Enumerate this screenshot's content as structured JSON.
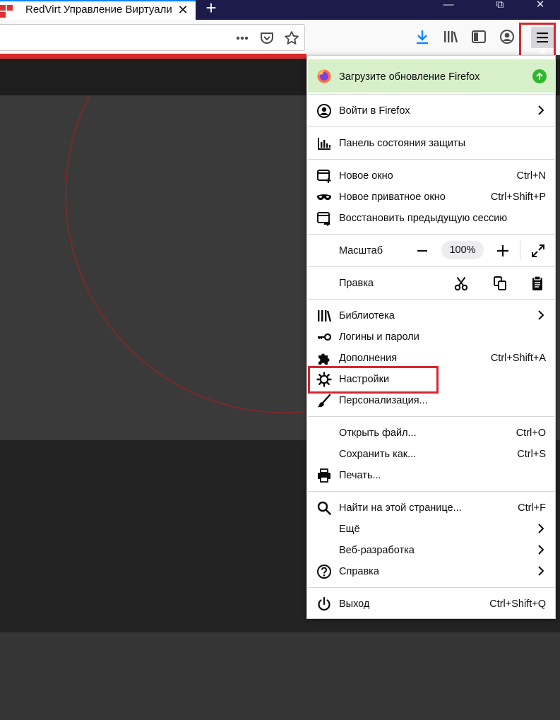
{
  "tab": {
    "title": "RedVirt Управление Виртуали",
    "close": "✕"
  },
  "new_tab": "+",
  "window": {
    "minimize": "—",
    "restore": "⧉",
    "close": "✕"
  },
  "toolbar": {
    "page_actions_icon": "more-horizontal-icon",
    "pocket_icon": "pocket-icon",
    "bookmark_icon": "star-icon",
    "downloads_icon": "download-icon",
    "library_icon": "library-icon",
    "sidebar_icon": "sidebar-icon",
    "account_icon": "account-icon",
    "menu_icon": "hamburger-menu-icon"
  },
  "colors": {
    "accent": "#0a84ff",
    "highlight": "#d7262f",
    "update_bg": "#d7f0c9",
    "update_badge": "#30b72f"
  },
  "menu": {
    "update": "Загрузите обновление Firefox",
    "signin": "Войти в Firefox",
    "protections": "Панель состояния защиты",
    "new_window": {
      "label": "Новое окно",
      "shortcut": "Ctrl+N"
    },
    "private_window": {
      "label": "Новое приватное окно",
      "shortcut": "Ctrl+Shift+P"
    },
    "restore_session": "Восстановить предыдущую сессию",
    "zoom": {
      "label": "Масштаб",
      "value": "100%",
      "minus": "−",
      "plus": "+"
    },
    "edit": {
      "label": "Правка"
    },
    "library": "Библиотека",
    "logins": "Логины и пароли",
    "addons": {
      "label": "Дополнения",
      "shortcut": "Ctrl+Shift+A"
    },
    "settings": "Настройки",
    "customize": "Персонализация...",
    "open_file": {
      "label": "Открыть файл...",
      "shortcut": "Ctrl+O"
    },
    "save_as": {
      "label": "Сохранить как...",
      "shortcut": "Ctrl+S"
    },
    "print": "Печать...",
    "find": {
      "label": "Найти на этой странице...",
      "shortcut": "Ctrl+F"
    },
    "more": "Ещё",
    "webdev": "Веб-разработка",
    "help": "Справка",
    "exit": {
      "label": "Выход",
      "shortcut": "Ctrl+Shift+Q"
    }
  }
}
